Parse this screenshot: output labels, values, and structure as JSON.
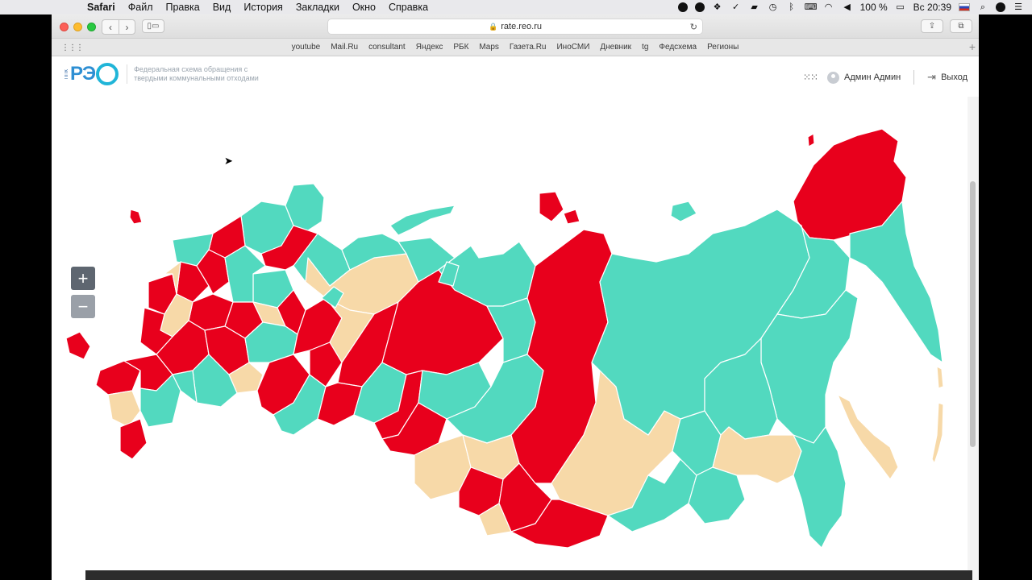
{
  "menubar": {
    "app": "Safari",
    "items": [
      "Файл",
      "Правка",
      "Вид",
      "История",
      "Закладки",
      "Окно",
      "Справка"
    ],
    "battery": "100 %",
    "clock": "Вс 20:39"
  },
  "browser": {
    "url": "rate.reo.ru",
    "favorites": [
      "youtube",
      "Mail.Ru",
      "consultant",
      "Яндекс",
      "РБК",
      "Maps",
      "Газета.Ru",
      "ИноСМИ",
      "Дневник",
      "tg",
      "Федсхема",
      "Регионы"
    ]
  },
  "header": {
    "logo_small": "ППК",
    "logo_text": "РЭ",
    "tagline": "Федеральная схема обращения с твердыми коммунальными отходами",
    "user_name": "Админ Админ",
    "logout_label": "Выход"
  },
  "map": {
    "zoom_in_label": "+",
    "zoom_out_label": "−",
    "colors": {
      "red": "#e8001c",
      "teal": "#52d9bf",
      "beige": "#f7d9a8"
    }
  }
}
